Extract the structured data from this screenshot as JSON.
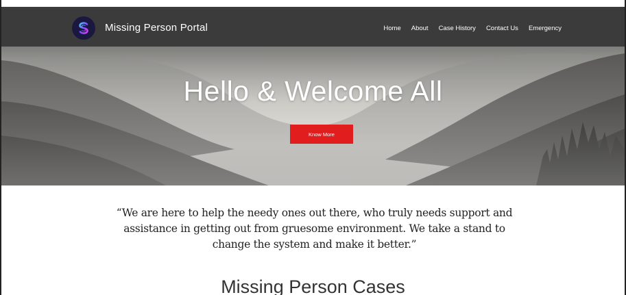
{
  "header": {
    "brand": "Missing Person Portal",
    "nav": [
      "Home",
      "About",
      "Case History",
      "Contact Us",
      "Emergency"
    ]
  },
  "hero": {
    "title": "Hello & Welcome All",
    "button_label": "Know More",
    "button_color": "#e11d1d"
  },
  "quote": {
    "text": "“We are here to help the needy ones out there, who truly needs support and assistance in getting out from gruesome environment. We take a stand to change the system and make it better.”"
  },
  "section": {
    "title": "Missing Person Cases"
  },
  "colors": {
    "navbar": "#3b3b3b",
    "accent": "#e11d1d"
  },
  "icons": {
    "logo": "swirl-logo-icon"
  }
}
